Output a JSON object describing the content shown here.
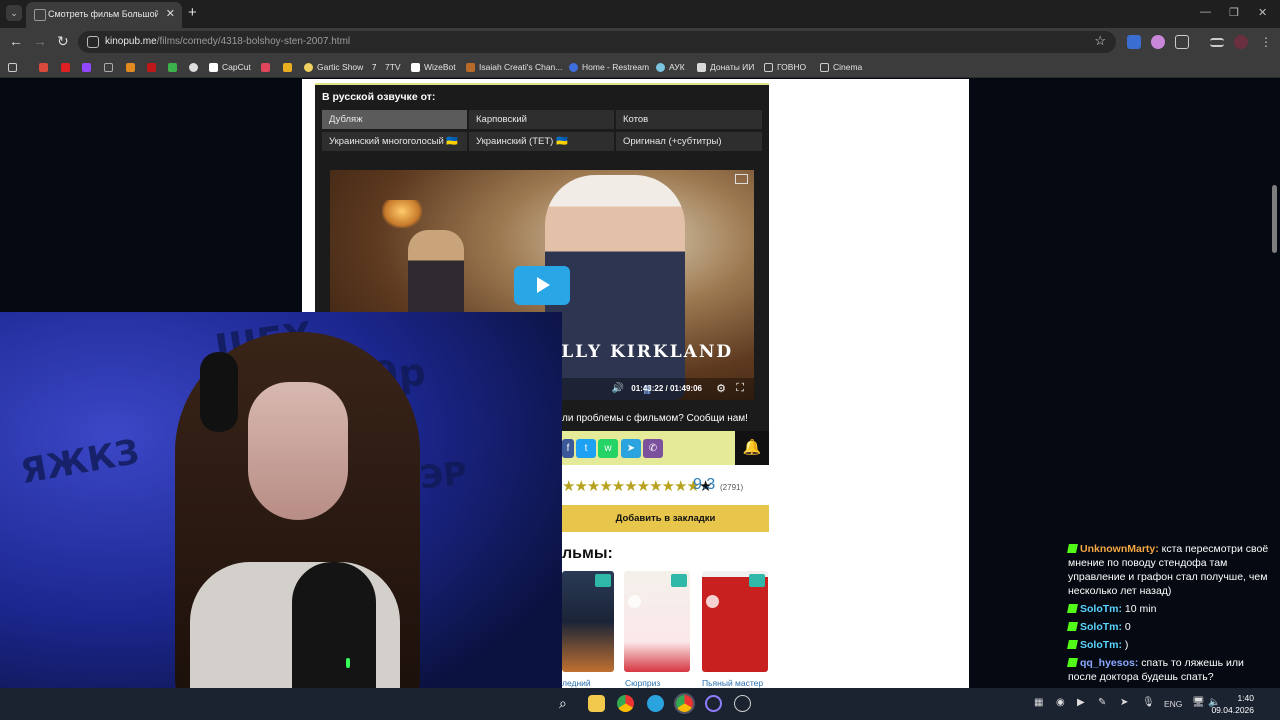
{
  "browser": {
    "tab_title": "Смотреть фильм Большой Стэн",
    "url_host": "kinopub.me",
    "url_path": "/films/comedy/4318-bolshoy-sten-2007.html",
    "bookmarks": [
      "CapCut",
      "Gartic Show",
      "7TV",
      "WizeBot",
      "Isaiah Creati's Chan...",
      "Home - Restream",
      "АУК",
      "Донаты ИИ",
      "ГОВНО",
      "Cinema"
    ]
  },
  "player": {
    "voice_title": "В русской озвучке от:",
    "voices": [
      "Дубляж",
      "Карповский",
      "Котов",
      "Украинский многоголосый 🇺🇦",
      "Украинский (ТЕТ) 🇺🇦",
      "Оригинал (+субтитры)"
    ],
    "video_credit": "ALLY KIRKLAND",
    "time": "01:43:22 / 01:49:06",
    "report_text": "ли проблемы с фильмом? Сообщи нам!"
  },
  "rating": {
    "score": "9.3",
    "votes": "(2791)",
    "stars_filled": 11,
    "stars_total": 12
  },
  "bookmark_button": "Добавить в закладки",
  "similar": {
    "title": "льмы:",
    "items": [
      "ледний",
      "Сюрприз",
      "Пьяный мастер"
    ]
  },
  "chat": [
    {
      "user": "UnknownMarty:",
      "color": "#f5a742",
      "text": "кста пересмотри своё мнение по поводу стендофа там управление и графон стал получше, чем несколько лет назад)"
    },
    {
      "user": "SoloTm:",
      "color": "#5bd4ff",
      "text": "10 min"
    },
    {
      "user": "SoloTm:",
      "color": "#5bd4ff",
      "text": "0"
    },
    {
      "user": "SoloTm:",
      "color": "#5bd4ff",
      "text": ")"
    },
    {
      "user": "qq_hyesos:",
      "color": "#8aa7ff",
      "text": "спать то ляжешь или после доктора будешь спать?"
    }
  ],
  "taskbar": {
    "lang": "ENG",
    "time": "1:40",
    "date": "09.04.2026"
  },
  "colors": {
    "accent": "#29a6e6",
    "chat_badge": "#53fc18",
    "bookmark_button": "#e8c64c"
  }
}
